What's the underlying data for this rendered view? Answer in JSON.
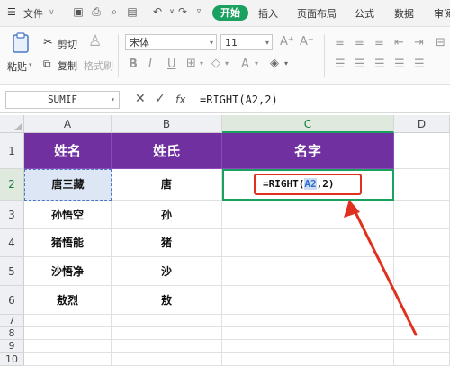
{
  "menu": {
    "file": "文件",
    "tabs": [
      "开始",
      "插入",
      "页面布局",
      "公式",
      "数据",
      "审阅"
    ]
  },
  "ribbon": {
    "cut": "剪切",
    "paste": "粘贴",
    "copy": "复制",
    "format_painter": "格式刷",
    "font_name": "宋体",
    "font_size": "11"
  },
  "formula_bar": {
    "name_box": "SUMIF",
    "fx": "fx",
    "formula": "=RIGHT(A2,2)"
  },
  "columns": [
    "A",
    "B",
    "C",
    "D"
  ],
  "rows": [
    "1",
    "2",
    "3",
    "4",
    "5",
    "6",
    "7",
    "8",
    "9",
    "10"
  ],
  "table": {
    "headers": [
      "姓名",
      "姓氏",
      "名字"
    ],
    "rows": [
      [
        "唐三藏",
        "唐"
      ],
      [
        "孙悟空",
        "孙"
      ],
      [
        "猪悟能",
        "猪"
      ],
      [
        "沙悟净",
        "沙"
      ],
      [
        "敖烈",
        "敖"
      ]
    ]
  },
  "editing_cell": {
    "prefix": "=RIGHT(",
    "ref": "A2",
    "suffix": ",2)"
  },
  "colors": {
    "header_fill": "#7030a0",
    "accent_green": "#1aa15f",
    "annotation_red": "#e0301e",
    "ref_blue": "#2f6fd1"
  }
}
